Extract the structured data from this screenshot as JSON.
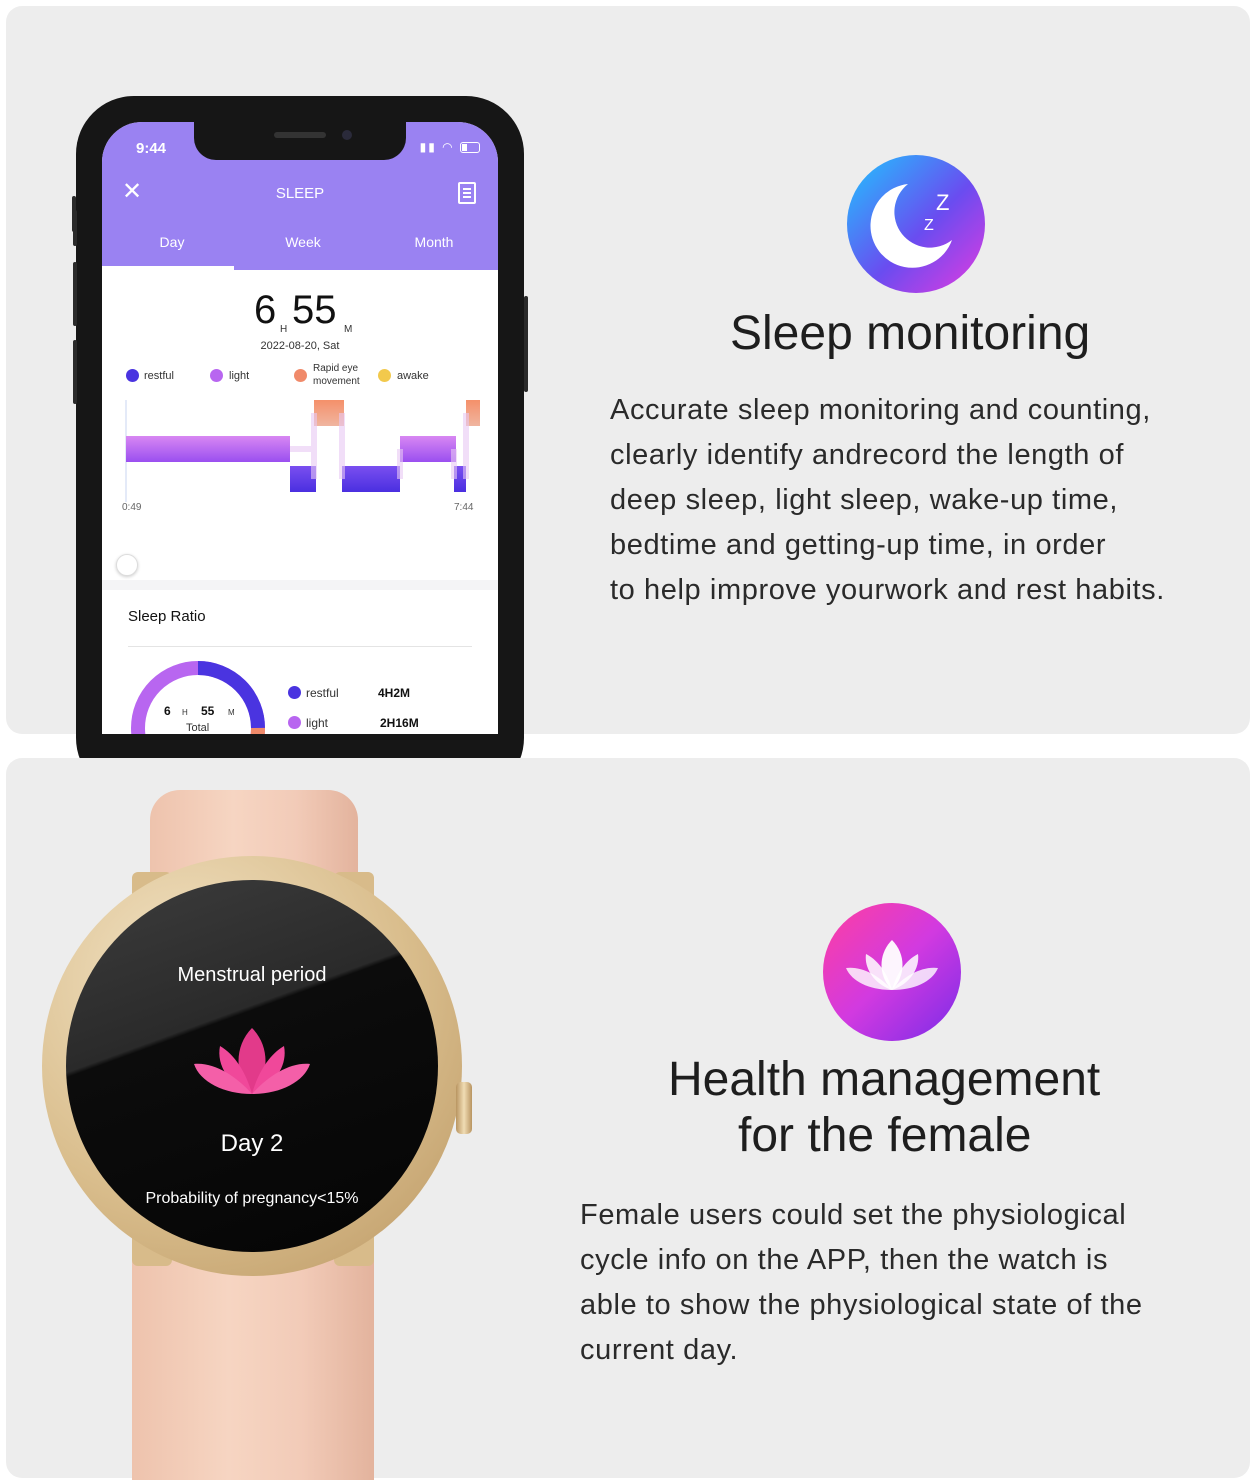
{
  "sleep_app": {
    "status_time": "9:44",
    "title": "SLEEP",
    "tabs": [
      "Day",
      "Week",
      "Month"
    ],
    "total_hours": "6",
    "hours_unit": "H",
    "total_minutes": "55",
    "minutes_unit": "M",
    "date": "2022-08-20, Sat",
    "legend": {
      "restful": "restful",
      "light": "light",
      "rem_line1": "Rapid eye",
      "rem_line2": "movement",
      "awake": "awake"
    },
    "chart": {
      "start_label": "0:49",
      "end_label": "7:44"
    },
    "ratio": {
      "title": "Sleep Ratio",
      "ring_hours": "6",
      "ring_h": "H",
      "ring_minutes": "55",
      "ring_m": "M",
      "ring_total": "Total",
      "rows": [
        {
          "label": "restful",
          "value": "4H2M"
        },
        {
          "label": "light",
          "value": "2H16M"
        }
      ]
    },
    "colors": {
      "header": "#9a82f2",
      "restful": "#4a34e0",
      "light": "#b866f0",
      "rem": "#f08a6a",
      "awake": "#f2c94c"
    }
  },
  "sleep_section": {
    "heading": "Sleep monitoring",
    "description": "Accurate sleep monitoring and counting,\nclearly identify andrecord the length of\ndeep sleep, light sleep, wake-up time,\nbedtime and getting-up time, in order\nto help improve yourwork and rest habits.",
    "icon": "moon-sleep-icon"
  },
  "watch": {
    "title": "Menstrual period",
    "day": "Day 2",
    "probability": "Probability of pregnancy<15%",
    "icon": "lotus-icon"
  },
  "female_section": {
    "heading_line1": "Health management",
    "heading_line2": "for the female",
    "description": "Female users could set the physiological\ncycle info on the APP, then the watch is\nable to show the physiological state of the\ncurrent day.",
    "icon": "lotus-icon"
  }
}
